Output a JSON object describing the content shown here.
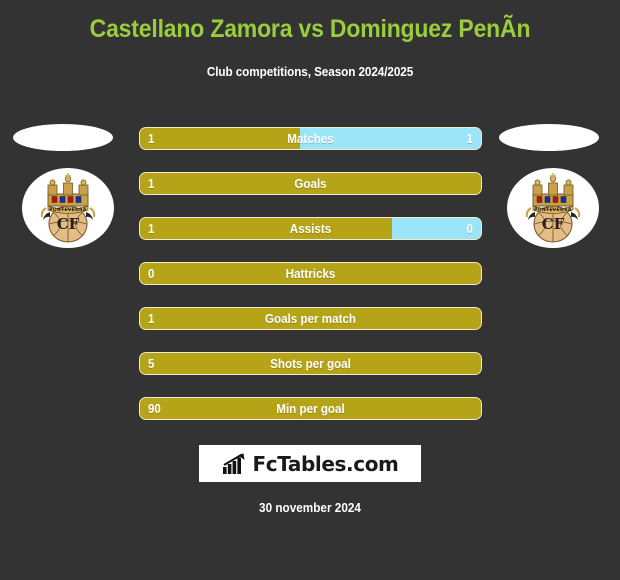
{
  "header": {
    "title": "Castellano Zamora vs Dominguez PenÃn",
    "subtitle": "Club competitions, Season 2024/2025"
  },
  "colors": {
    "background": "#333333",
    "title_green": "#9ACD3C",
    "bar_gold": "#B5A318",
    "bar_blue": "#9CE4F8",
    "text_white": "#FFFFFF",
    "logo_background": "#FFFFFF"
  },
  "teams": {
    "left": {
      "crest_name": "pontevedra-cf-crest",
      "crest_text": "CF",
      "crest_band_text": "PONTEVEDRA"
    },
    "right": {
      "crest_name": "pontevedra-cf-crest",
      "crest_text": "CF",
      "crest_band_text": "PONTEVEDRA"
    }
  },
  "chart_data": {
    "type": "bar",
    "title": "Castellano Zamora vs Dominguez PenÃn",
    "subtitle": "Club competitions, Season 2024/2025",
    "orientation": "horizontal-diverging",
    "categories": [
      "Matches",
      "Goals",
      "Assists",
      "Hattricks",
      "Goals per match",
      "Shots per goal",
      "Min per goal"
    ],
    "series": [
      {
        "name": "Castellano Zamora",
        "color": "#B5A318",
        "values": [
          "1",
          "1",
          "1",
          "0",
          "1",
          "5",
          "90"
        ]
      },
      {
        "name": "Dominguez PenÃn",
        "color": "#9CE4F8",
        "values": [
          "1",
          "",
          "0",
          "",
          "",
          "",
          ""
        ]
      }
    ],
    "legend": "none",
    "grid": false
  },
  "stats": [
    {
      "label": "Matches",
      "left_value": "1",
      "right_value": "1",
      "left_pct": 47,
      "right_pct": 53,
      "has_right": true
    },
    {
      "label": "Goals",
      "left_value": "1",
      "right_value": "",
      "left_pct": 100,
      "right_pct": 0,
      "has_right": false
    },
    {
      "label": "Assists",
      "left_value": "1",
      "right_value": "0",
      "left_pct": 74,
      "right_pct": 26,
      "has_right": true
    },
    {
      "label": "Hattricks",
      "left_value": "0",
      "right_value": "",
      "left_pct": 100,
      "right_pct": 0,
      "has_right": false
    },
    {
      "label": "Goals per match",
      "left_value": "1",
      "right_value": "",
      "left_pct": 100,
      "right_pct": 0,
      "has_right": false
    },
    {
      "label": "Shots per goal",
      "left_value": "5",
      "right_value": "",
      "left_pct": 100,
      "right_pct": 0,
      "has_right": false
    },
    {
      "label": "Min per goal",
      "left_value": "90",
      "right_value": "",
      "left_pct": 100,
      "right_pct": 0,
      "has_right": false
    }
  ],
  "footer": {
    "logo_text": "FcTables.com",
    "logo_icon": "bar-chart-arrow-icon",
    "date": "30 november 2024"
  }
}
